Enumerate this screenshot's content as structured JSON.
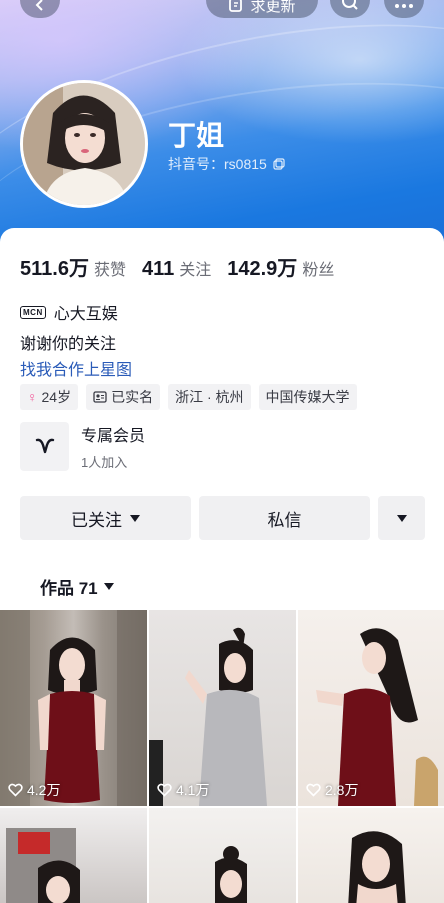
{
  "top_bar": {
    "update_label": "求更新"
  },
  "profile": {
    "nickname": "丁姐",
    "douyin_id": "抖音号：rs0815"
  },
  "stats": [
    {
      "num": "511.6万",
      "label": "获赞"
    },
    {
      "num": "411",
      "label": "关注"
    },
    {
      "num": "142.9万",
      "label": "粉丝"
    }
  ],
  "mcn": {
    "badge": "MCN",
    "name": "心大互娱"
  },
  "bio": "谢谢你的关注",
  "xingtu_link": "找我合作上星图",
  "tags": [
    "24岁",
    "已实名",
    "浙江 · 杭州",
    "中国传媒大学"
  ],
  "member": {
    "title": "专属会员",
    "subtitle": "1人加入"
  },
  "actions": {
    "followed": "已关注",
    "message": "私信"
  },
  "works_tab": "作品 71",
  "videos": [
    {
      "likes": "4.2万"
    },
    {
      "likes": "4.1万"
    },
    {
      "likes": "2.8万"
    }
  ],
  "colors": {
    "link": "#2a5bb8",
    "female_icon": "#f25a9a",
    "header_blue": "#1a78e0"
  }
}
